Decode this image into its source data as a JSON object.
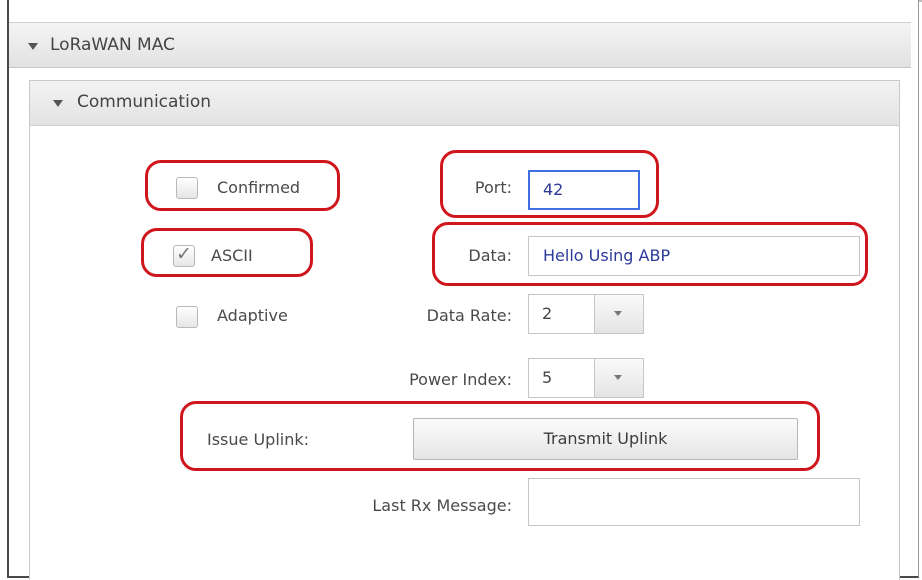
{
  "sections": {
    "mac_title": "LoRaWAN MAC",
    "comm_title": "Communication"
  },
  "checkboxes": {
    "confirmed": {
      "label": "Confirmed",
      "checked": false
    },
    "ascii": {
      "label": "ASCII",
      "checked": true
    },
    "adaptive": {
      "label": "Adaptive",
      "checked": false
    }
  },
  "fields": {
    "port_label": "Port:",
    "port_value": "42",
    "data_label": "Data:",
    "data_value": "Hello Using ABP",
    "data_rate_label": "Data Rate:",
    "data_rate_value": "2",
    "power_index_label": "Power Index:",
    "power_index_value": "5",
    "issue_uplink_label": "Issue Uplink:",
    "transmit_button": "Transmit Uplink",
    "last_rx_label": "Last Rx Message:",
    "last_rx_value": ""
  },
  "colors": {
    "annotation_red": "#d0161d",
    "focus_blue": "#3f6fe0",
    "value_text_blue": "#2c3a99"
  },
  "icons": {
    "expand": "triangle-down-icon",
    "dropdown": "chevron-down-icon",
    "check": "checkmark-icon"
  }
}
